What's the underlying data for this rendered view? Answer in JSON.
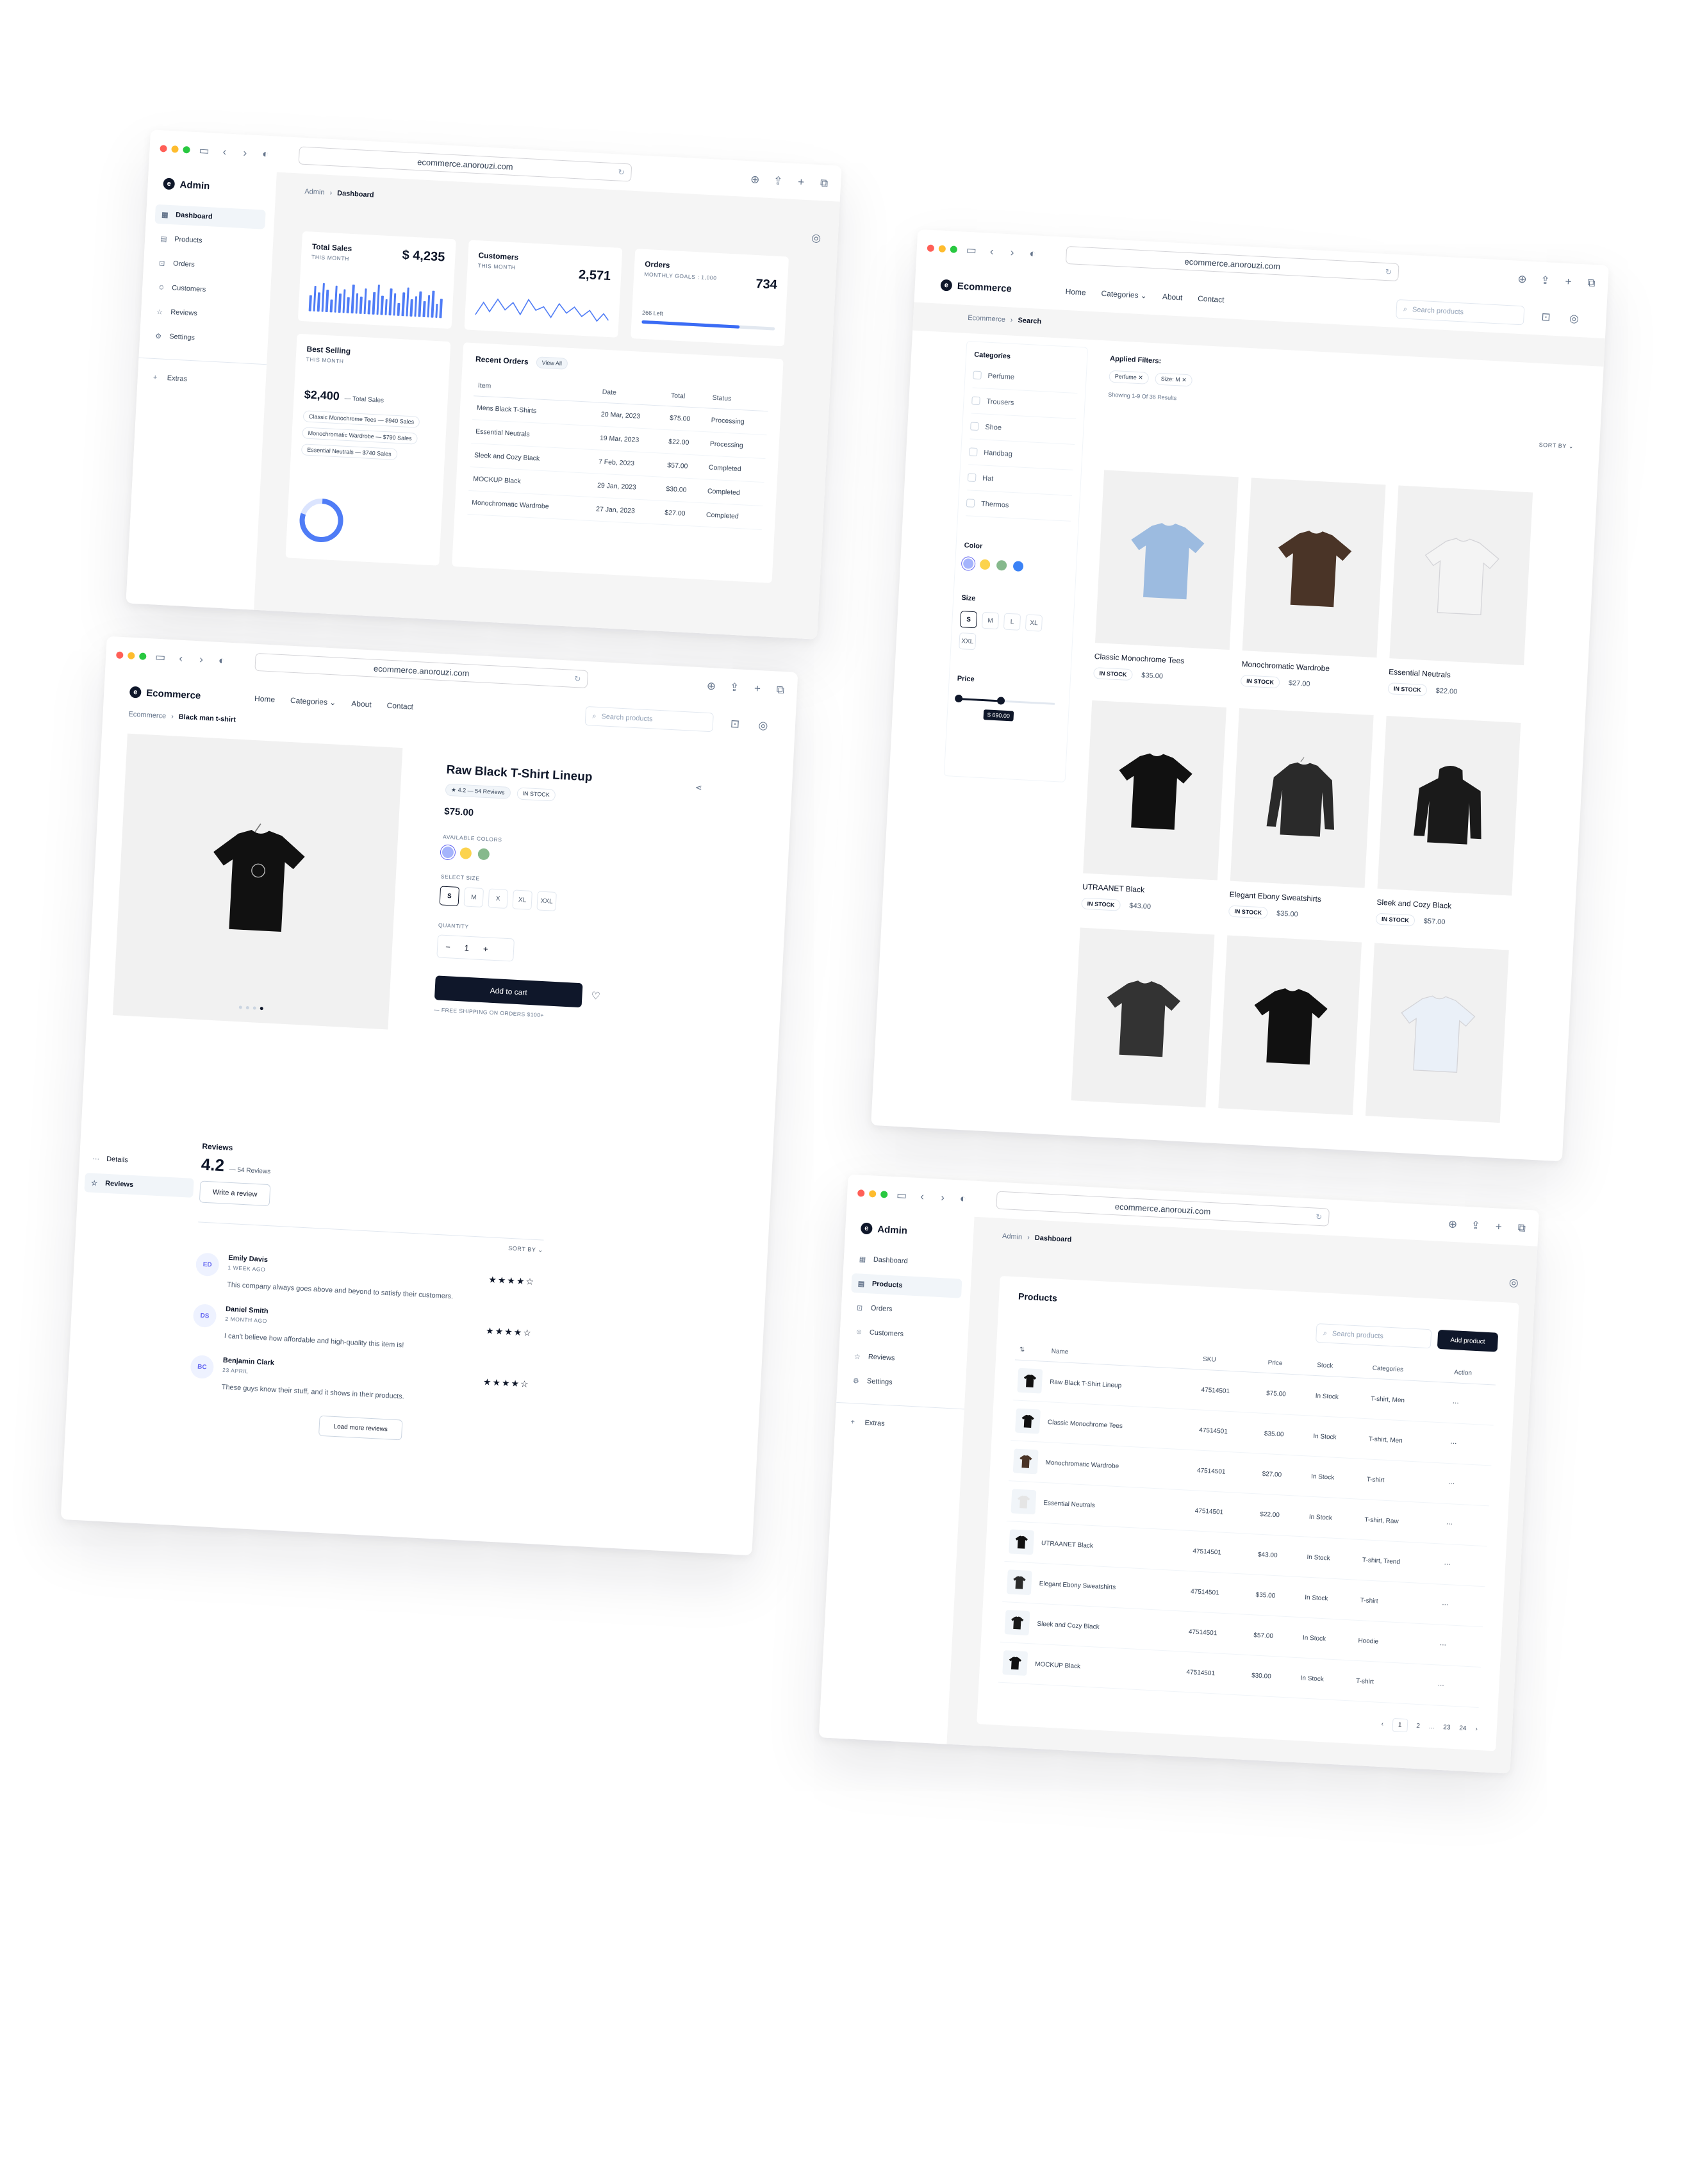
{
  "url": "ecommerce.anorouzi.com",
  "admin": {
    "brand": "Admin",
    "breadcrumb": {
      "root": "Admin",
      "current": "Dashboard"
    },
    "nav": [
      "Dashboard",
      "Products",
      "Orders",
      "Customers",
      "Reviews",
      "Settings"
    ],
    "extras": "Extras",
    "total_sales": {
      "label": "Total Sales",
      "period": "THIS MONTH",
      "value": "$ 4,235"
    },
    "customers": {
      "label": "Customers",
      "period": "THIS MONTH",
      "value": "2,571"
    },
    "orders": {
      "label": "Orders",
      "goal": "MONTHLY GOALS : 1,000",
      "value": "734",
      "left": "266 Left",
      "progress": 0.734
    },
    "best_selling": {
      "label": "Best Selling",
      "period": "THIS MONTH",
      "value": "$2,400",
      "suffix": "— Total Sales",
      "items": [
        "Classic Monochrome Tees — $940 Sales",
        "Monochromatic Wardrobe — $790 Sales",
        "Essential Neutrals — $740 Sales"
      ]
    },
    "recent_orders": {
      "label": "Recent Orders",
      "view_all": "View All",
      "headers": [
        "Item",
        "Date",
        "Total",
        "Status"
      ],
      "rows": [
        [
          "Mens Black T-Shirts",
          "20 Mar, 2023",
          "$75.00",
          "Processing"
        ],
        [
          "Essential Neutrals",
          "19 Mar, 2023",
          "$22.00",
          "Processing"
        ],
        [
          "Sleek and Cozy Black",
          "7 Feb, 2023",
          "$57.00",
          "Completed"
        ],
        [
          "MOCKUP Black",
          "29 Jan, 2023",
          "$30.00",
          "Completed"
        ],
        [
          "Monochromatic Wardrobe",
          "27 Jan, 2023",
          "$27.00",
          "Completed"
        ]
      ]
    }
  },
  "shop": {
    "brand": "Ecommerce",
    "nav": [
      "Home",
      "Categories",
      "About",
      "Contact"
    ],
    "search_placeholder": "Search products",
    "breadcrumb": {
      "root": "Ecommerce",
      "current": "Search"
    },
    "filters": {
      "categories_label": "Categories",
      "categories": [
        "Perfume",
        "Trousers",
        "Shoe",
        "Handbag",
        "Hat",
        "Thermos"
      ],
      "color_label": "Color",
      "colors": [
        "#a5b4fc",
        "#fcd34d",
        "#86b98c",
        "#3b82f6"
      ],
      "size_label": "Size",
      "sizes": [
        "S",
        "M",
        "L",
        "XL",
        "XXL"
      ],
      "price_label": "Price",
      "price_value": "$ 690.00"
    },
    "applied_label": "Applied Filters:",
    "applied": [
      "Perfume",
      "Size: M"
    ],
    "showing": "Showing 1-9 Of 36 Results",
    "sort": "SORT BY",
    "stock_label": "IN STOCK",
    "products": [
      {
        "name": "Classic Monochrome Tees",
        "price": "$35.00",
        "color": "#9cbbe0",
        "kind": "tee"
      },
      {
        "name": "Monochromatic Wardrobe",
        "price": "$27.00",
        "color": "#4a3427",
        "kind": "tee"
      },
      {
        "name": "Essential Neutrals",
        "price": "$22.00",
        "color": "#f4f4f4",
        "kind": "tee"
      },
      {
        "name": "UTRAANET Black",
        "price": "$43.00",
        "color": "#111111",
        "kind": "tee"
      },
      {
        "name": "Elegant Ebony Sweatshirts",
        "price": "$35.00",
        "color": "#2a2a2a",
        "kind": "sweat"
      },
      {
        "name": "Sleek and Cozy Black",
        "price": "$57.00",
        "color": "#1a1a1a",
        "kind": "hoodie"
      },
      {
        "name": "",
        "price": "",
        "color": "#333333",
        "kind": "tee"
      },
      {
        "name": "",
        "price": "",
        "color": "#111111",
        "kind": "tee"
      },
      {
        "name": "",
        "price": "",
        "color": "#eaf0f8",
        "kind": "tee"
      }
    ]
  },
  "detail": {
    "breadcrumb": {
      "root": "Ecommerce",
      "current": "Black man t-shirt"
    },
    "title": "Raw Black T-Shirt Lineup",
    "rating": "4.2 — 54 Reviews",
    "stock": "IN STOCK",
    "price": "$75.00",
    "colors_label": "AVAILABLE COLORS",
    "colors": [
      "#a5b4fc",
      "#fcd34d",
      "#86b98c"
    ],
    "size_label": "SELECT SIZE",
    "sizes": [
      "S",
      "M",
      "X",
      "XL",
      "XXL"
    ],
    "qty_label": "QUANTITY",
    "qty": "1",
    "cart": "Add to cart",
    "shipping": "— FREE SHIPPING ON ORDERS $100+",
    "tabs": [
      "Details",
      "Reviews"
    ],
    "reviews_label": "Reviews",
    "score": "4.2",
    "score_sub": "— 54 Reviews",
    "write": "Write a review",
    "sort": "SORT BY",
    "reviews": [
      {
        "initials": "ED",
        "name": "Emily Davis",
        "when": "1 WEEK AGO",
        "text": "This company always goes above and beyond to satisfy their customers."
      },
      {
        "initials": "DS",
        "name": "Daniel Smith",
        "when": "2 MONTH AGO",
        "text": "I can't believe how affordable and high-quality this item is!"
      },
      {
        "initials": "BC",
        "name": "Benjamin Clark",
        "when": "23 APRIL",
        "text": "These guys know their stuff, and it shows in their products."
      }
    ],
    "load_more": "Load more reviews",
    "stars": "★★★★☆"
  },
  "products_admin": {
    "title": "Products",
    "search_placeholder": "Search products",
    "add": "Add product",
    "headers": [
      "Name",
      "SKU",
      "Price",
      "Stock",
      "Categories",
      "Action"
    ],
    "rows": [
      [
        "Raw Black T-Shirt Lineup",
        "47514501",
        "$75.00",
        "In Stock",
        "T-shirt, Men"
      ],
      [
        "Classic Monochrome Tees",
        "47514501",
        "$35.00",
        "In Stock",
        "T-shirt, Men"
      ],
      [
        "Monochromatic Wardrobe",
        "47514501",
        "$27.00",
        "In Stock",
        "T-shirt"
      ],
      [
        "Essential Neutrals",
        "47514501",
        "$22.00",
        "In Stock",
        "T-shirt, Raw"
      ],
      [
        "UTRAANET Black",
        "47514501",
        "$43.00",
        "In Stock",
        "T-shirt, Trend"
      ],
      [
        "Elegant Ebony Sweatshirts",
        "47514501",
        "$35.00",
        "In Stock",
        "T-shirt"
      ],
      [
        "Sleek and Cozy Black",
        "47514501",
        "$57.00",
        "In Stock",
        "Hoodie"
      ],
      [
        "MOCKUP Black",
        "47514501",
        "$30.00",
        "In Stock",
        "T-shirt"
      ]
    ],
    "pages": [
      "1",
      "2",
      "...",
      "23",
      "24"
    ]
  },
  "sales_bars": [
    0.5,
    0.8,
    0.6,
    0.9,
    0.7,
    0.4,
    0.85,
    0.6,
    0.75,
    0.5,
    0.9,
    0.65,
    0.55,
    0.8,
    0.45,
    0.7,
    0.95,
    0.6,
    0.5,
    0.85,
    0.7,
    0.4,
    0.75,
    0.9,
    0.55,
    0.65,
    0.8,
    0.5,
    0.7,
    0.85,
    0.45,
    0.6
  ]
}
